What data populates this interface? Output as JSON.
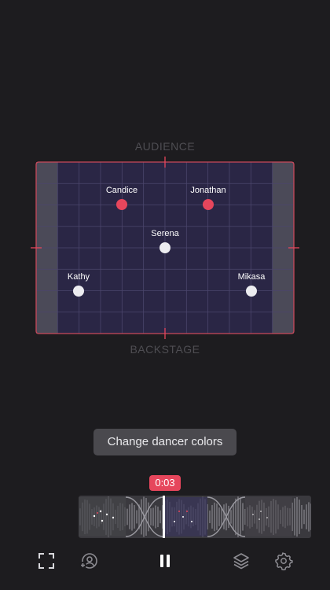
{
  "stage": {
    "audience_label": "AUDIENCE",
    "backstage_label": "BACKSTAGE"
  },
  "dancers": [
    {
      "name": "Candice",
      "color": "#e6465c"
    },
    {
      "name": "Jonathan",
      "color": "#e6465c"
    },
    {
      "name": "Serena",
      "color": "#ececf0"
    },
    {
      "name": "Kathy",
      "color": "#ececf0"
    },
    {
      "name": "Mikasa",
      "color": "#ececf0"
    }
  ],
  "tooltip": {
    "text": "Change dancer colors"
  },
  "playback": {
    "time": "0:03"
  },
  "colors": {
    "accent": "#e6465c",
    "stage_fill": "#2a2645",
    "grid": "#4b466c",
    "background": "#1d1c1f"
  },
  "toolbar": {
    "icons": [
      "fullscreen-icon",
      "add-dancer-icon",
      "pause-icon",
      "layers-icon",
      "settings-icon"
    ]
  }
}
